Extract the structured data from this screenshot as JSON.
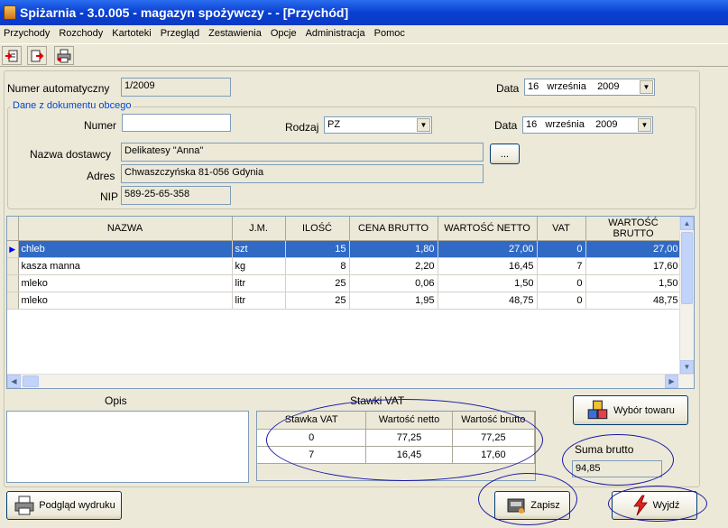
{
  "window": {
    "title": "Spiżarnia - 3.0.005 - magazyn spożywczy -  - [Przychód]"
  },
  "menu": [
    "Przychody",
    "Rozchody",
    "Kartoteki",
    "Przegląd",
    "Zestawienia",
    "Opcje",
    "Administracja",
    "Pomoc"
  ],
  "form": {
    "auto_number_label": "Numer automatyczny",
    "auto_number_value": "1/2009",
    "date_label": "Data",
    "date_day": "16",
    "date_month": "września",
    "date_year": "2009",
    "group_title": "Dane z dokumentu obcego",
    "number_label": "Numer",
    "number_value": "",
    "type_label": "Rodzaj",
    "type_value": "PZ",
    "date2_label": "Data",
    "date2_day": "16",
    "date2_month": "września",
    "date2_year": "2009",
    "supplier_label": "Nazwa dostawcy",
    "supplier_value": "Delikatesy \"Anna\"",
    "browse_label": "...",
    "address_label": "Adres",
    "address_value": "Chwaszczyńska 81-056 Gdynia",
    "nip_label": "NIP",
    "nip_value": "589-25-65-358"
  },
  "grid": {
    "columns": [
      "NAZWA",
      "J.M.",
      "ILOŚĆ",
      "CENA BRUTTO",
      "WARTOŚĆ NETTO",
      "VAT",
      "WARTOŚĆ BRUTTO"
    ],
    "rows": [
      [
        "chleb",
        "szt",
        "15",
        "1,80",
        "27,00",
        "0",
        "27,00"
      ],
      [
        "kasza manna",
        "kg",
        "8",
        "2,20",
        "16,45",
        "7",
        "17,60"
      ],
      [
        "mleko",
        "litr",
        "25",
        "0,06",
        "1,50",
        "0",
        "1,50"
      ],
      [
        "mleko",
        "litr",
        "25",
        "1,95",
        "48,75",
        "0",
        "48,75"
      ]
    ]
  },
  "notes": {
    "label": "Opis",
    "value": ""
  },
  "vat": {
    "title": "Stawki VAT",
    "columns": [
      "Stawka VAT",
      "Wartość netto",
      "Wartość brutto"
    ],
    "rows": [
      [
        "0",
        "77,25",
        "77,25"
      ],
      [
        "7",
        "16,45",
        "17,60"
      ]
    ]
  },
  "buttons": {
    "choose_product": "Wybór towaru",
    "print_preview": "Podgląd wydruku",
    "save": "Zapisz",
    "exit": "Wyjdź"
  },
  "total": {
    "label": "Suma brutto",
    "value": "94,85"
  },
  "icons": {
    "toolbar": [
      "new-document-icon",
      "export-icon",
      "print-icon"
    ],
    "app": "pantry-app-icon"
  }
}
